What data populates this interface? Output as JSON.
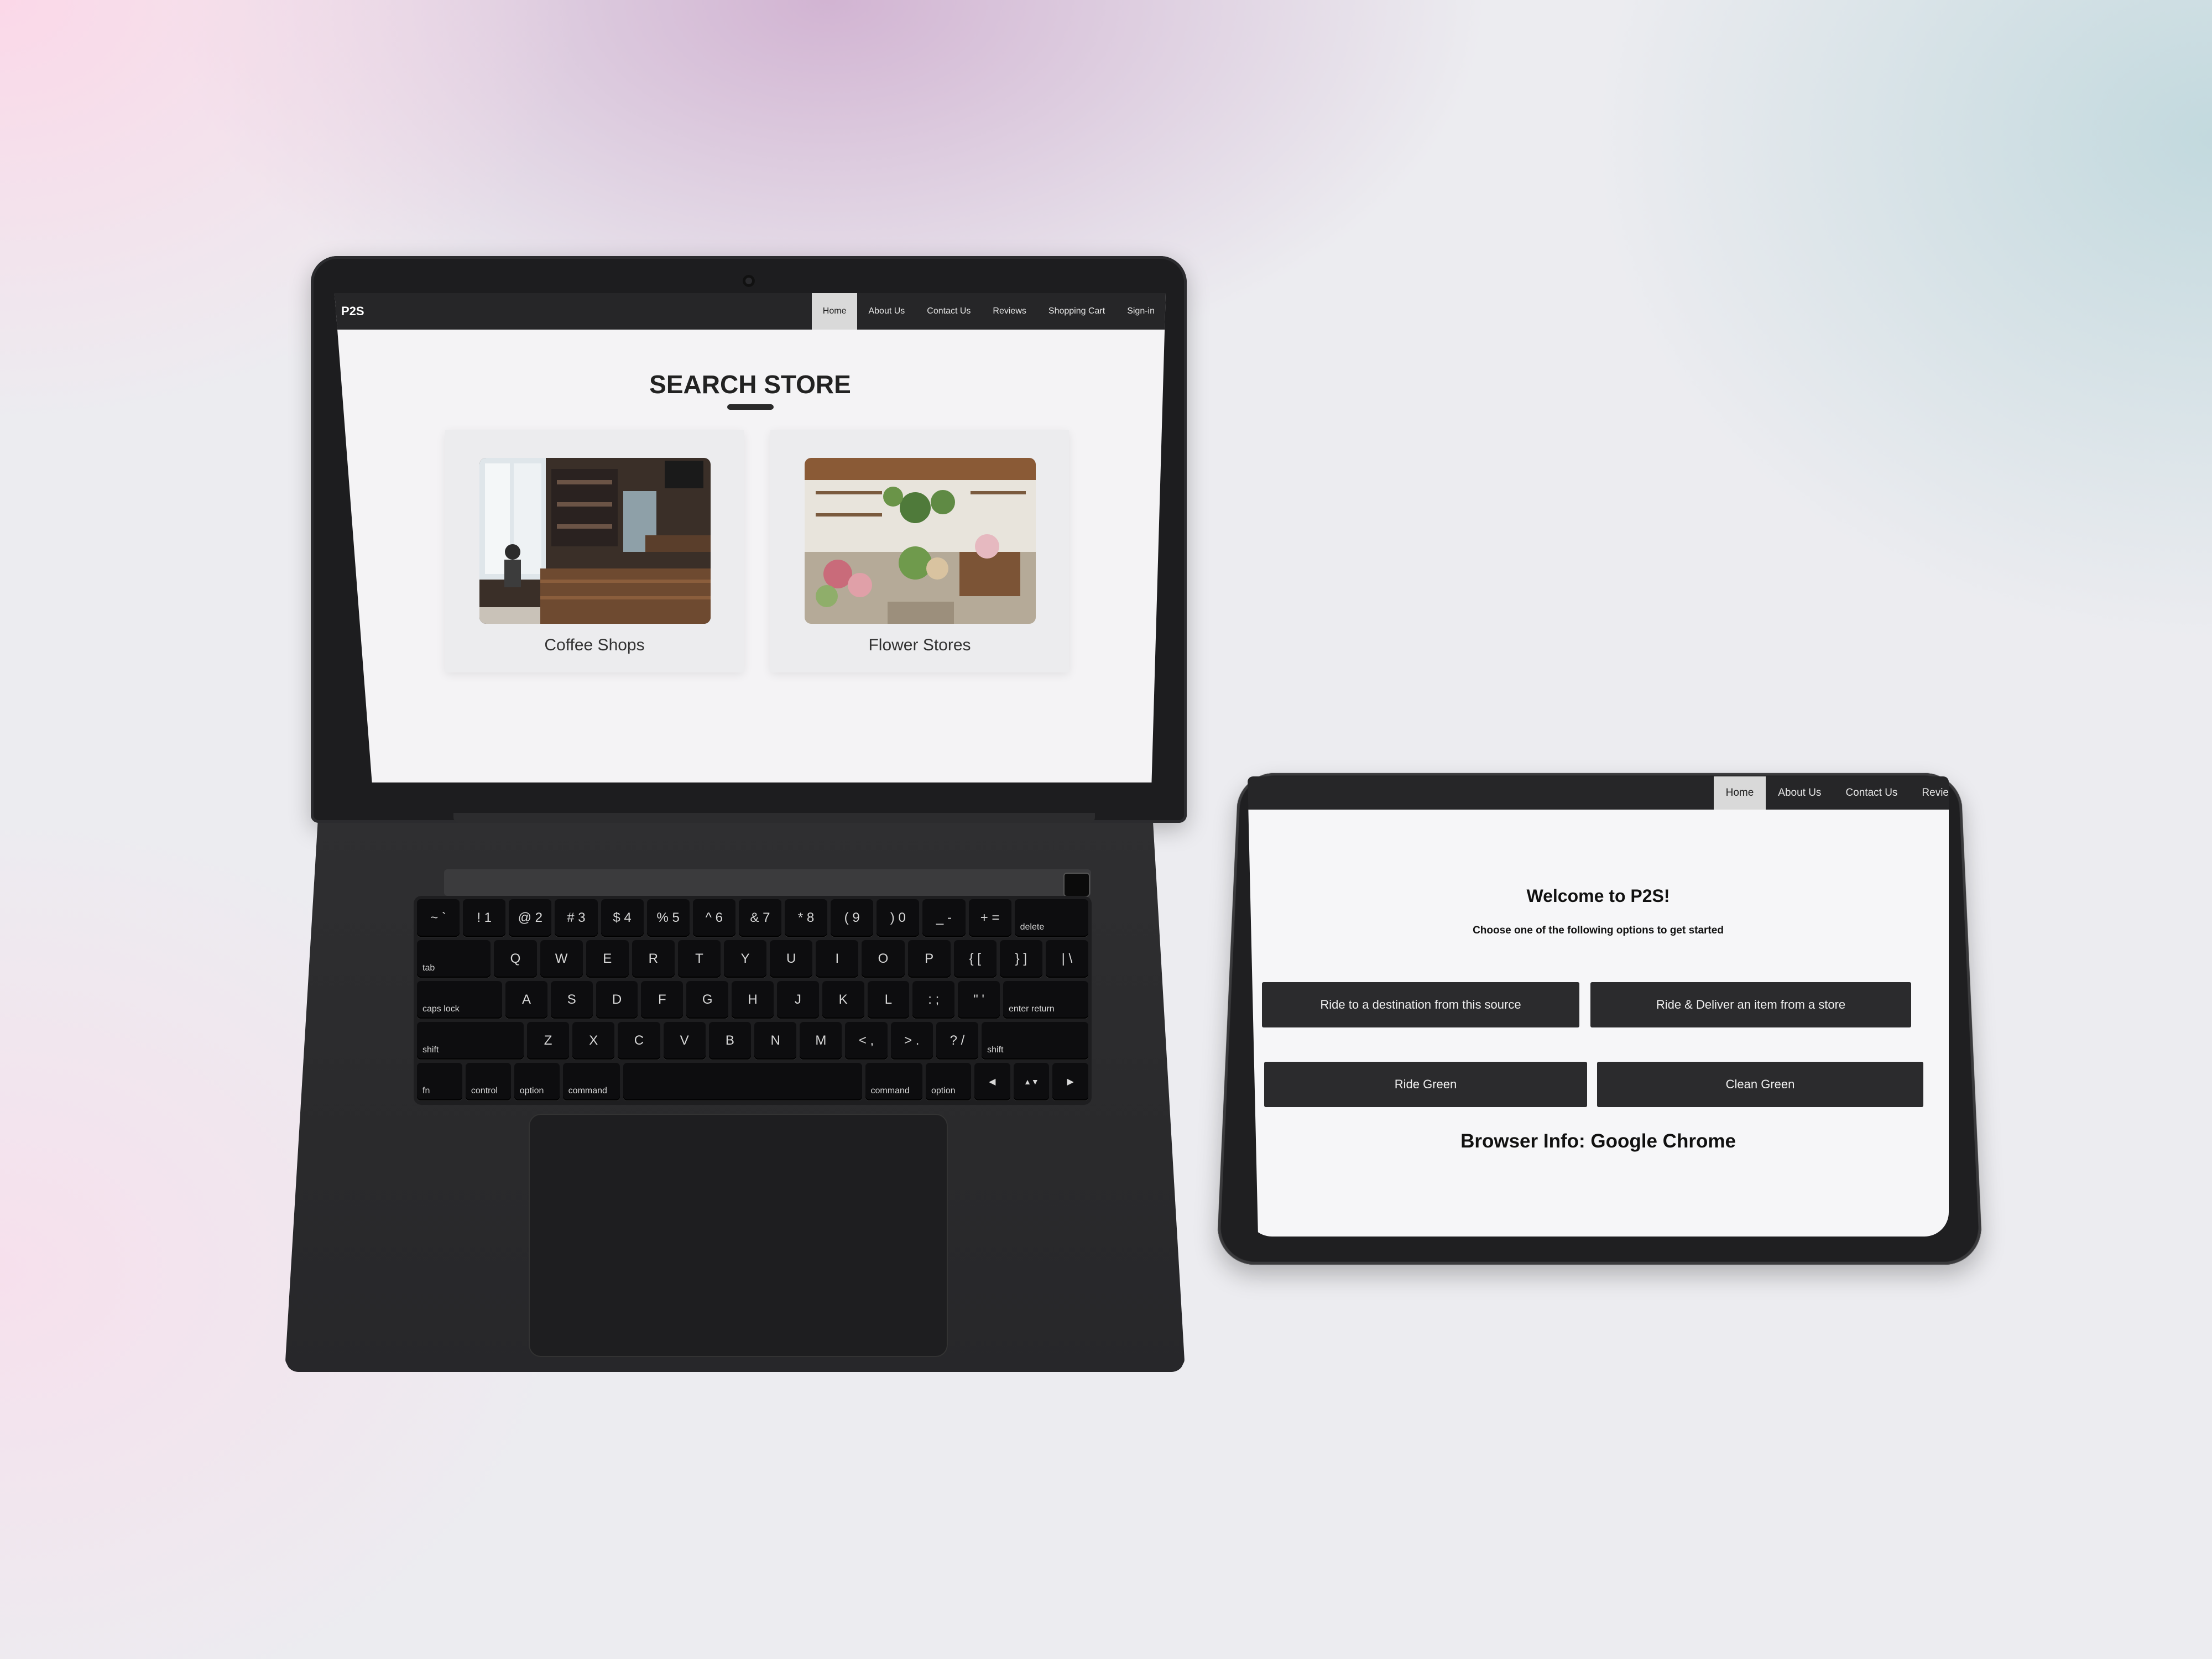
{
  "laptop": {
    "nav": {
      "brand": "P2S",
      "items": [
        "Home",
        "About Us",
        "Contact Us",
        "Reviews",
        "Shopping Cart",
        "Sign-in"
      ]
    },
    "page_title": "SEARCH STORE",
    "cards": [
      {
        "label": "Coffee Shops",
        "image": "coffee-shop-photo"
      },
      {
        "label": "Flower Stores",
        "image": "flower-store-photo"
      }
    ],
    "keyboard": {
      "row1": [
        "~ `",
        "! 1",
        "@ 2",
        "# 3",
        "$ 4",
        "% 5",
        "^ 6",
        "& 7",
        "* 8",
        "( 9",
        ") 0",
        "_ -",
        "+ =",
        "delete"
      ],
      "row2": [
        "tab",
        "Q",
        "W",
        "E",
        "R",
        "T",
        "Y",
        "U",
        "I",
        "O",
        "P",
        "{ [",
        "} ]",
        "| \\"
      ],
      "row3": [
        "caps lock",
        "A",
        "S",
        "D",
        "F",
        "G",
        "H",
        "J",
        "K",
        "L",
        ": ;",
        "\" '",
        "enter return"
      ],
      "row4": [
        "shift",
        "Z",
        "X",
        "C",
        "V",
        "B",
        "N",
        "M",
        "< ,",
        "> .",
        "? /",
        "shift"
      ],
      "row5": [
        "fn",
        "control",
        "option",
        "command",
        "",
        "command",
        "option",
        "◀",
        "▲▼",
        "▶"
      ]
    }
  },
  "tablet": {
    "nav": {
      "items": [
        "Home",
        "About Us",
        "Contact Us",
        "Revie"
      ]
    },
    "welcome": "Welcome to P2S!",
    "subtitle": "Choose one of the following options to get started",
    "buttons": [
      "Ride to a destination from this source",
      "Ride & Deliver an item from a store",
      "Ride Green",
      "Clean Green"
    ],
    "browser_info": "Browser Info: Google Chrome"
  }
}
